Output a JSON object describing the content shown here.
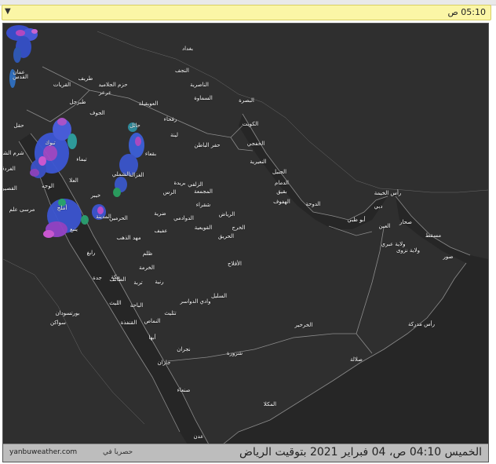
{
  "selector": {
    "value": "05:10 ص",
    "arrow": "▼"
  },
  "footer": {
    "timestamp": "الخميس 04:10 ص، 04 فبراير 2021 بتوقيت الرياض",
    "site": "yanbuweather.com",
    "credit_prefix": "حصريا في"
  },
  "cities": [
    {
      "name": "بغداد"
    },
    {
      "name": "النجف"
    },
    {
      "name": "الناصرية"
    },
    {
      "name": "السماوة"
    },
    {
      "name": "البصرة"
    },
    {
      "name": "الكويت"
    },
    {
      "name": "عمان"
    },
    {
      "name": "القدس"
    },
    {
      "name": "القريات"
    },
    {
      "name": "طريف"
    },
    {
      "name": "حزم الجلاميد"
    },
    {
      "name": "عرعر"
    },
    {
      "name": "طبرجل"
    },
    {
      "name": "العويقيلة"
    },
    {
      "name": "رفحاء"
    },
    {
      "name": "الجوف"
    },
    {
      "name": "حقل"
    },
    {
      "name": "تبوك"
    },
    {
      "name": "شرم الشيخ"
    },
    {
      "name": "تيماء"
    },
    {
      "name": "الغردقة"
    },
    {
      "name": "حائل"
    },
    {
      "name": "لينة"
    },
    {
      "name": "حفر الباطن"
    },
    {
      "name": "الخفجي"
    },
    {
      "name": "بقعاء"
    },
    {
      "name": "الجبيل"
    },
    {
      "name": "النعيرية"
    },
    {
      "name": "الدمام"
    },
    {
      "name": "بقيق"
    },
    {
      "name": "الهفوف"
    },
    {
      "name": "الدوحة"
    },
    {
      "name": "الغزالة"
    },
    {
      "name": "الشملي"
    },
    {
      "name": "العلا"
    },
    {
      "name": "القصير"
    },
    {
      "name": "الوجه"
    },
    {
      "name": "مرسى علم"
    },
    {
      "name": "خيبر"
    },
    {
      "name": "بريدة"
    },
    {
      "name": "الزلفي"
    },
    {
      "name": "المجمعة"
    },
    {
      "name": "الرس"
    },
    {
      "name": "شقراء"
    },
    {
      "name": "الرياض"
    },
    {
      "name": "الخرج"
    },
    {
      "name": "الدوادمي"
    },
    {
      "name": "ضرية"
    },
    {
      "name": "عفيف"
    },
    {
      "name": "القويعية"
    },
    {
      "name": "الحريق"
    },
    {
      "name": "أملج"
    },
    {
      "name": "ينبع"
    },
    {
      "name": "المدينة"
    },
    {
      "name": "الحرمين"
    },
    {
      "name": "مهد الذهب"
    },
    {
      "name": "رابغ"
    },
    {
      "name": "ظلم"
    },
    {
      "name": "جدة"
    },
    {
      "name": "مكة"
    },
    {
      "name": "الطائف"
    },
    {
      "name": "الخرمة"
    },
    {
      "name": "رنية"
    },
    {
      "name": "تربة"
    },
    {
      "name": "الليث"
    },
    {
      "name": "الباحة"
    },
    {
      "name": "السليل"
    },
    {
      "name": "وادي الدواسر"
    },
    {
      "name": "الأفلاج"
    },
    {
      "name": "بورتسودان"
    },
    {
      "name": "سواكن"
    },
    {
      "name": "القنفذة"
    },
    {
      "name": "النماص"
    },
    {
      "name": "تثليث"
    },
    {
      "name": "أبها"
    },
    {
      "name": "نجران"
    },
    {
      "name": "جازان"
    },
    {
      "name": "شرورة"
    },
    {
      "name": "صنعاء"
    },
    {
      "name": "الخرخير"
    },
    {
      "name": "صلالة"
    },
    {
      "name": "المكلا"
    },
    {
      "name": "عدن"
    },
    {
      "name": "رأس الخيمة"
    },
    {
      "name": "دبي"
    },
    {
      "name": "أبو ظبي"
    },
    {
      "name": "العين"
    },
    {
      "name": "صحار"
    },
    {
      "name": "مسقط"
    },
    {
      "name": "ولاية عبري"
    },
    {
      "name": "ولاية نزوى"
    },
    {
      "name": "صور"
    },
    {
      "name": "رأس مدركة"
    }
  ]
}
